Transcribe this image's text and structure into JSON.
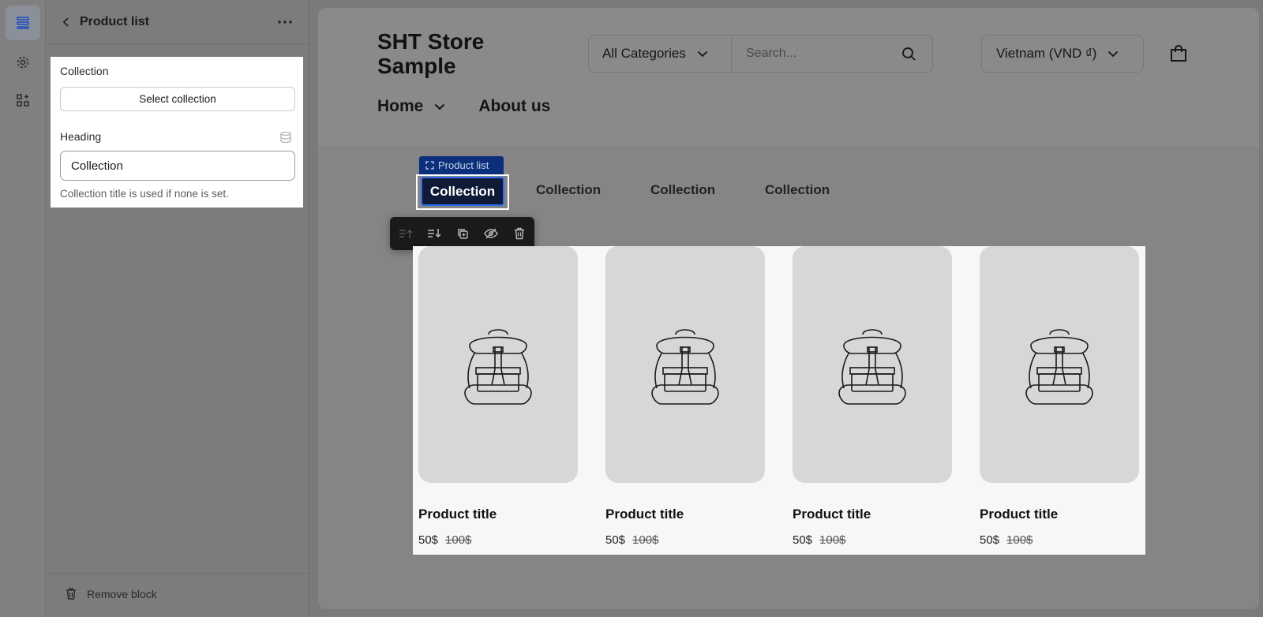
{
  "editor": {
    "panel_title": "Product list",
    "collection_label": "Collection",
    "select_collection_label": "Select collection",
    "heading_label": "Heading",
    "heading_value": "Collection",
    "help_text": "Collection title is used if none is set.",
    "remove_block_label": "Remove block"
  },
  "store": {
    "name": "SHT Store Sample",
    "category_select": "All Categories",
    "search_placeholder": "Search...",
    "currency": "Vietnam (VND ₫)",
    "nav": [
      {
        "label": "Home"
      },
      {
        "label": "About us"
      }
    ]
  },
  "block_tag": "Product list",
  "tabs": [
    {
      "label": "Collection"
    },
    {
      "label": "Collection"
    },
    {
      "label": "Collection"
    },
    {
      "label": "Collection"
    }
  ],
  "products": [
    {
      "title": "Product title",
      "price": "50$",
      "compare_price": "100$"
    },
    {
      "title": "Product title",
      "price": "50$",
      "compare_price": "100$"
    },
    {
      "title": "Product title",
      "price": "50$",
      "compare_price": "100$"
    },
    {
      "title": "Product title",
      "price": "50$",
      "compare_price": "100$"
    }
  ],
  "colors": {
    "selection_blue": "#2e6cf0",
    "tag_bg": "#0b2f7a",
    "active_tab_bg": "#0f1a36"
  }
}
